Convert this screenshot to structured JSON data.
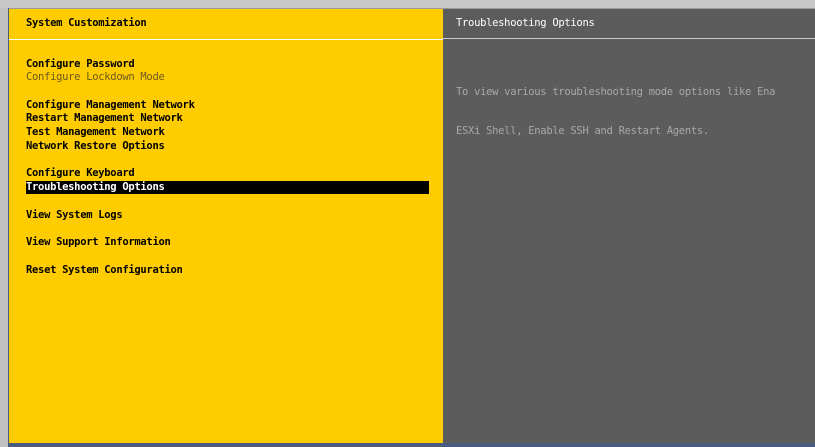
{
  "left_panel": {
    "title": "System Customization",
    "groups": [
      {
        "items": [
          {
            "label": "Configure Password",
            "enabled": true
          },
          {
            "label": "Configure Lockdown Mode",
            "enabled": false
          }
        ]
      },
      {
        "items": [
          {
            "label": "Configure Management Network",
            "enabled": true
          },
          {
            "label": "Restart Management Network",
            "enabled": true
          },
          {
            "label": "Test Management Network",
            "enabled": true
          },
          {
            "label": "Network Restore Options",
            "enabled": true
          }
        ]
      },
      {
        "items": [
          {
            "label": "Configure Keyboard",
            "enabled": true
          },
          {
            "label": "Troubleshooting Options",
            "enabled": true,
            "selected": true
          }
        ]
      },
      {
        "items": [
          {
            "label": "View System Logs",
            "enabled": true
          }
        ]
      },
      {
        "items": [
          {
            "label": "View Support Information",
            "enabled": true
          }
        ]
      },
      {
        "items": [
          {
            "label": "Reset System Configuration",
            "enabled": true
          }
        ]
      }
    ]
  },
  "right_panel": {
    "title": "Troubleshooting Options",
    "description_lines": [
      "To view various troubleshooting mode options like Ena",
      "ESXi Shell, Enable SSH and Restart Agents."
    ]
  },
  "colors": {
    "left_panel_bg": "#ffcc00",
    "right_panel_bg": "#5c5c5c",
    "selection_bg": "#000000",
    "selection_fg": "#ffffff",
    "disabled_fg": "#6b5a1e"
  }
}
